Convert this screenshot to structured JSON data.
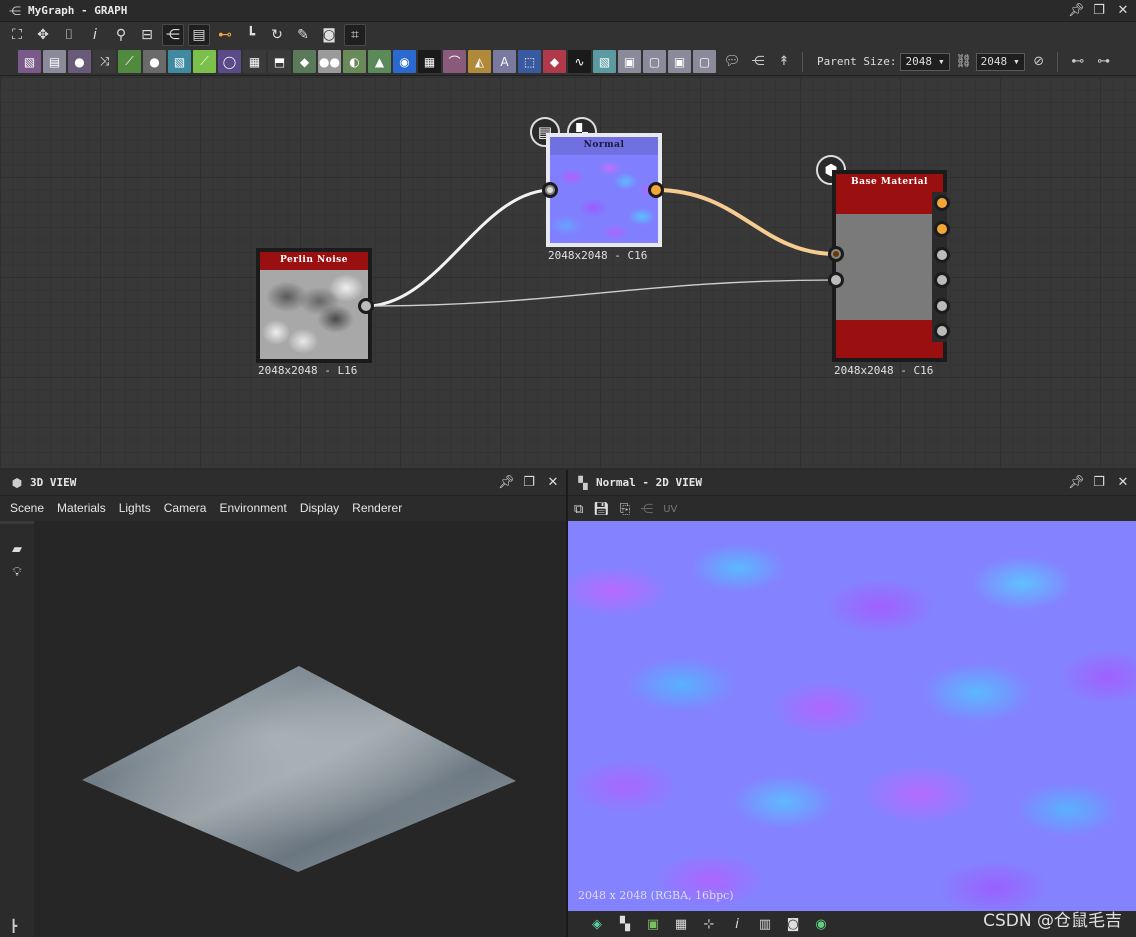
{
  "graph_window": {
    "title": "MyGraph - GRAPH",
    "controls": [
      "pin-icon",
      "maximize-icon",
      "close-icon"
    ]
  },
  "toolbar1": {
    "icons": [
      "frame-icon",
      "fit-icon",
      "camera-icon",
      "info-icon",
      "search-icon",
      "align-icon",
      "tree-icon",
      "library-icon",
      "wire-icon",
      "step-icon",
      "refresh-icon",
      "wrench-icon",
      "display-icon",
      "crop-icon"
    ]
  },
  "node_buttons": [
    {
      "name": "bitmap",
      "color": "#7a5a8a",
      "glyph": "▧"
    },
    {
      "name": "svg",
      "color": "#8a8a9a",
      "glyph": "▤"
    },
    {
      "name": "uniform-color",
      "color": "#6a5a7a",
      "glyph": "●"
    },
    {
      "name": "blend",
      "color": "#3a3a3a",
      "glyph": "⤨"
    },
    {
      "name": "curve",
      "color": "#4f8a3e",
      "glyph": "⟋"
    },
    {
      "name": "levels",
      "color": "#6a6a6a",
      "glyph": "●"
    },
    {
      "name": "normal",
      "color": "#3f8aa0",
      "glyph": "▧"
    },
    {
      "name": "gradient",
      "color": "#7ac04a",
      "glyph": "⟋"
    },
    {
      "name": "shape",
      "color": "#5a4a8a",
      "glyph": "◯"
    },
    {
      "name": "tile",
      "color": "#3a3a3a",
      "glyph": "▦"
    },
    {
      "name": "transform",
      "color": "#3a3a3a",
      "glyph": "⬒"
    },
    {
      "name": "warp",
      "color": "#5a7a5a",
      "glyph": "◆"
    },
    {
      "name": "input",
      "color": "#9a9a9a",
      "glyph": "●●"
    },
    {
      "name": "emboss",
      "color": "#6a8a5a",
      "glyph": "◐"
    },
    {
      "name": "histogram",
      "color": "#5a8a5a",
      "glyph": "▲"
    },
    {
      "name": "hsl",
      "color": "#2a6ad0",
      "glyph": "◉"
    },
    {
      "name": "pixel",
      "color": "#1a1a1a",
      "glyph": "▦"
    },
    {
      "name": "fxmap",
      "color": "#8a5a7a",
      "glyph": "⌒"
    },
    {
      "name": "mirror",
      "color": "#b08a3a",
      "glyph": "◭"
    },
    {
      "name": "text",
      "color": "#7a7aa0",
      "glyph": "A"
    },
    {
      "name": "select",
      "color": "#3a5aa0",
      "glyph": "⬚"
    },
    {
      "name": "fill",
      "color": "#b03a4a",
      "glyph": "◆"
    },
    {
      "name": "value",
      "color": "#1a1a1a",
      "glyph": "∿"
    },
    {
      "name": "output",
      "color": "#5a9aa0",
      "glyph": "▧"
    },
    {
      "name": "graph-a",
      "color": "#8a8a9a",
      "glyph": "▣"
    },
    {
      "name": "graph-b",
      "color": "#8a8a9a",
      "glyph": "▢"
    },
    {
      "name": "graph-c",
      "color": "#8a8a9a",
      "glyph": "▣"
    },
    {
      "name": "graph-d",
      "color": "#8a8a9a",
      "glyph": "▢"
    }
  ],
  "toolbar2_tail": {
    "icons": [
      "comment-icon",
      "pin-icon",
      "pinhead-icon"
    ],
    "parent_size_label": "Parent Size:",
    "width_value": "2048",
    "height_value": "2048",
    "link_icon": "link-icon",
    "reset_icon": "reset-icon",
    "extra_icons": [
      "node-compact-icon",
      "node-expand-icon"
    ]
  },
  "nodes": {
    "perlin": {
      "header": "Perlin Noise",
      "resolution": "2048x2048 - L16",
      "header_color": "#9a1010"
    },
    "normal": {
      "header": "Normal",
      "resolution": "2048x2048 - C16",
      "header_color": "#6a6ae0"
    },
    "base_material": {
      "header": "Base Material",
      "resolution": "2048x2048 - C16",
      "header_color": "#9a1010"
    }
  },
  "view3d": {
    "title": "3D VIEW",
    "menu": [
      "Scene",
      "Materials",
      "Lights",
      "Camera",
      "Environment",
      "Display",
      "Renderer"
    ],
    "side_icons": [
      "camera-icon",
      "light-icon"
    ]
  },
  "view2d": {
    "title": "Normal - 2D VIEW",
    "tool_icons": [
      "export-icon",
      "save-icon",
      "copy-icon"
    ],
    "uv_label": "UV",
    "info": "2048 x 2048 (RGBA, 16bpc)",
    "bottom_icons": [
      "layers-icon",
      "checker-icon",
      "channels-icon",
      "grid-icon",
      "tile-icon",
      "info-icon",
      "histogram-icon",
      "display-icon",
      "colorwheel-icon"
    ],
    "watermark": "CSDN @仓鼠毛吉"
  }
}
